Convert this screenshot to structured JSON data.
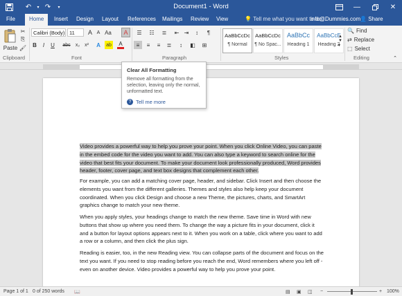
{
  "window": {
    "title": "Document1 - Word",
    "quick_access": {
      "save_icon": "save-icon",
      "undo_icon": "undo-icon",
      "redo_icon": "redo-icon"
    },
    "controls": [
      "ribbon-display-icon",
      "minimize-icon",
      "restore-icon",
      "close-icon"
    ]
  },
  "tabs": {
    "items": [
      {
        "label": "File"
      },
      {
        "label": "Home"
      },
      {
        "label": "Insert"
      },
      {
        "label": "Design"
      },
      {
        "label": "Layout"
      },
      {
        "label": "References"
      },
      {
        "label": "Mailings"
      },
      {
        "label": "Review"
      },
      {
        "label": "View"
      }
    ],
    "active": "Home",
    "tell_me": "Tell me what you want to do...",
    "signin": "info@Dummies.com",
    "share": "Share"
  },
  "ribbon": {
    "clipboard": {
      "paste_label": "Paste",
      "group_label": "Clipboard"
    },
    "font": {
      "font_name": "Calibri (Body)",
      "font_size": "11",
      "bold": "B",
      "italic": "I",
      "underline": "U",
      "strikethrough": "abc",
      "subscript": "x₂",
      "superscript": "x²",
      "text_effects": "A",
      "highlight": "ab",
      "font_color": "A",
      "grow": "A",
      "shrink": "A",
      "case": "Aa",
      "group_label": "Font"
    },
    "paragraph": {
      "group_label": "Paragraph",
      "pilcrow": "¶"
    },
    "styles": {
      "items": [
        {
          "sample": "AaBbCcDc",
          "name": "¶ Normal"
        },
        {
          "sample": "AaBbCcDc",
          "name": "¶ No Spac..."
        },
        {
          "sample": "AaBbCc",
          "name": "Heading 1"
        },
        {
          "sample": "AaBbCcE",
          "name": "Heading 2"
        }
      ],
      "group_label": "Styles"
    },
    "editing": {
      "find": "Find",
      "replace": "Replace",
      "select": "Select",
      "group_label": "Editing"
    }
  },
  "tooltip": {
    "title": "Clear All Formatting",
    "description": "Remove all formatting from the selection, leaving only the normal, unformatted text.",
    "help": "Tell me more"
  },
  "document": {
    "paragraphs": [
      "Video provides a powerful way to help you prove your point. When you click Online Video, you can paste in the embed code for the video you want to add. You can also type a keyword to search online for the video that best fits your document. To make your document look professionally produced, Word provides header, footer, cover page, and text box designs that complement each other.",
      "For example, you can add a matching cover page, header, and sidebar. Click Insert and then choose the elements you want from the different galleries. Themes and styles also help keep your document coordinated. When you click Design and choose a new Theme, the pictures, charts, and SmartArt graphics change to match your new theme.",
      "When you apply styles, your headings change to match the new theme. Save time in Word with new buttons that show up where you need them. To change the way a picture fits in your document, click it and a button for layout options appears next to it. When you work on a table, click where you want to add a row or a column, and then click the plus sign.",
      "Reading is easier, too, in the new Reading view. You can collapse parts of the document and focus on the text you want. If you need to stop reading before you reach the end, Word remembers where you left off - even on another device. Video provides a powerful way to help you prove your point."
    ]
  },
  "status": {
    "page": "Page 1 of 1",
    "words": "0 of 250 words",
    "zoom": "100%"
  },
  "colors": {
    "brand": "#2b579a",
    "selection": "#c8c8c8"
  }
}
